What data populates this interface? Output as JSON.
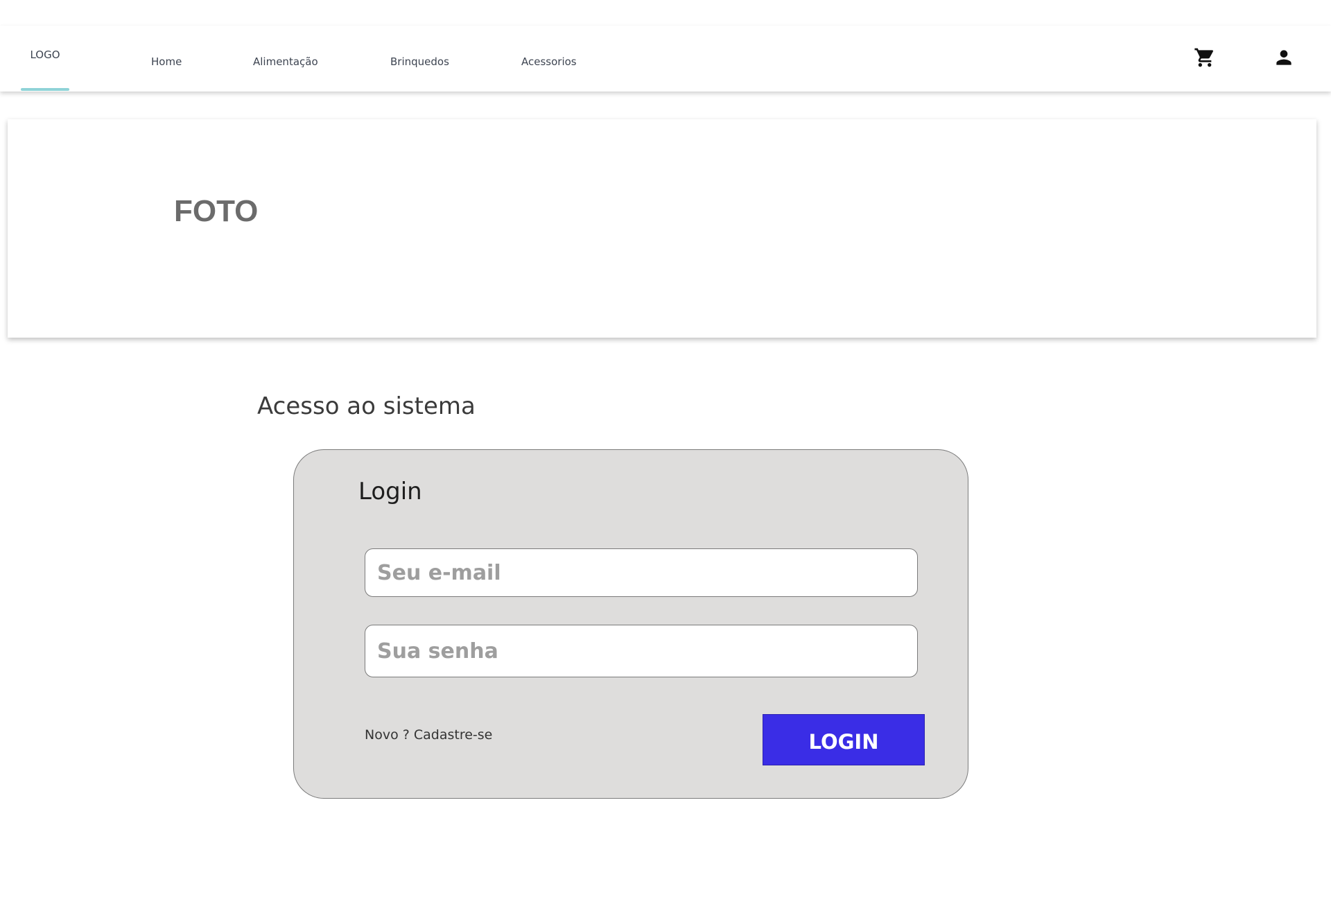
{
  "navbar": {
    "logo": "LOGO",
    "links": [
      {
        "label": "Home"
      },
      {
        "label": "Alimentação"
      },
      {
        "label": "Brinquedos"
      },
      {
        "label": "Acessorios"
      }
    ],
    "icons": {
      "cart": "shopping-cart-icon",
      "account": "user-icon"
    },
    "accent_color": "#8fd3d7"
  },
  "hero": {
    "label": "FOTO"
  },
  "section": {
    "title": "Acesso ao sistema"
  },
  "login_card": {
    "title": "Login",
    "email_placeholder": "Seu e-mail",
    "email_value": "",
    "password_placeholder": "Sua senha",
    "password_value": "",
    "signup_text": "Novo ? Cadastre-se",
    "login_button": "LOGIN",
    "button_color": "#3a2de6",
    "card_color": "#dedddc"
  }
}
